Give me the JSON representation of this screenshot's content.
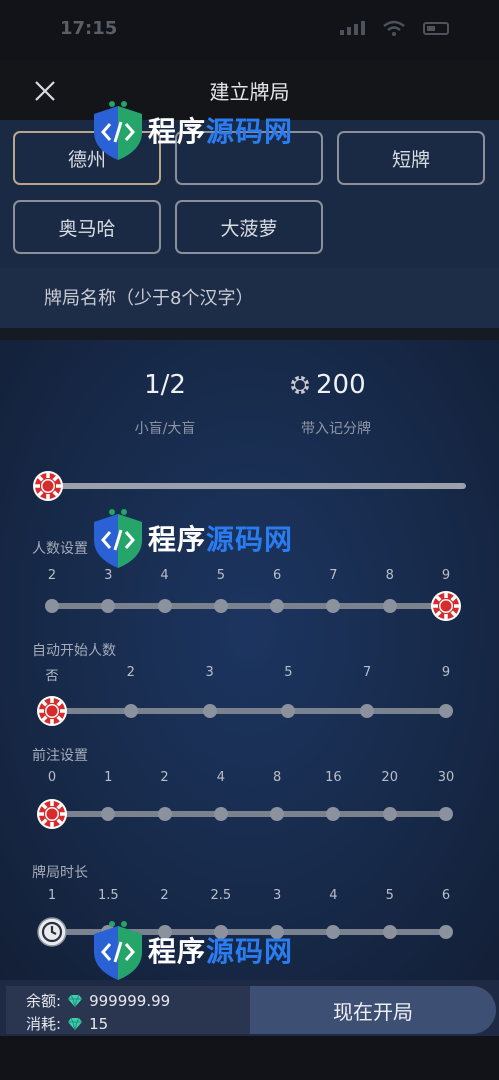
{
  "status_bar": {
    "time": "17:15"
  },
  "header": {
    "title": "建立牌局"
  },
  "game_types": [
    "德州",
    "",
    "短牌",
    "奥马哈",
    "大菠萝"
  ],
  "table_name": {
    "placeholder": "牌局名称（少于8个汉字）"
  },
  "blinds": {
    "value": "1/2",
    "label": "小盲/大盲",
    "level": 0
  },
  "buyin": {
    "value": "200",
    "label": "带入记分牌"
  },
  "players": {
    "label": "人数设置",
    "ticks": [
      "2",
      "3",
      "4",
      "5",
      "6",
      "7",
      "8",
      "9"
    ],
    "selected": "9"
  },
  "auto_start": {
    "label": "自动开始人数",
    "ticks": [
      "否",
      "2",
      "3",
      "5",
      "7",
      "9"
    ],
    "selected": "否"
  },
  "ante": {
    "label": "前注设置",
    "ticks": [
      "0",
      "1",
      "2",
      "4",
      "8",
      "16",
      "20",
      "30"
    ],
    "selected": "0"
  },
  "duration": {
    "label": "牌局时长",
    "ticks": [
      "1",
      "1.5",
      "2",
      "2.5",
      "3",
      "4",
      "5",
      "6"
    ],
    "selected": "1"
  },
  "balance": {
    "balance_label": "余额:",
    "balance_value": "999999.99",
    "cost_label": "消耗:",
    "cost_value": "15"
  },
  "start_button": {
    "label": "现在开局"
  },
  "watermark": {
    "part1": "程序",
    "part2": "源码网"
  },
  "colors": {
    "chip_red": "#d92b2b",
    "gem": "#3ecfb0",
    "accent_border": "#b9a68a"
  }
}
